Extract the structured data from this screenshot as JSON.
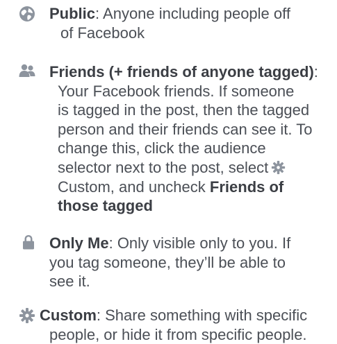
{
  "items": [
    {
      "icon": "globe-icon",
      "title": "Public",
      "separator": ":",
      "line1_rest": " Anyone including people off",
      "lines": [
        "of Facebook"
      ]
    },
    {
      "icon": "friends-icon",
      "title": "Friends (+ friends of anyone tagged)",
      "separator": ":",
      "lines": [
        "Your Facebook friends. If someone",
        "is tagged in the post, then the tagged",
        "person and their friends can see it. To",
        "change this, click the audience",
        "selector next to the post, select"
      ],
      "line6_start": "Custom, and uncheck ",
      "line6_bold": "Friends of",
      "line7_bold": "those tagged"
    },
    {
      "icon": "lock-icon",
      "title": "Only Me",
      "separator": ":",
      "line1_rest": " Only visible only to you. If",
      "lines": [
        "you tag someone, they’ll be able to",
        "see it."
      ]
    },
    {
      "icon": "gear-icon",
      "title": "Custom",
      "separator": ":",
      "line1_rest": " Share something with specific",
      "lines": [
        "people, or hide it from specific people."
      ]
    }
  ],
  "colors": {
    "text": "#4b4f56",
    "icon": "#8d949e"
  }
}
